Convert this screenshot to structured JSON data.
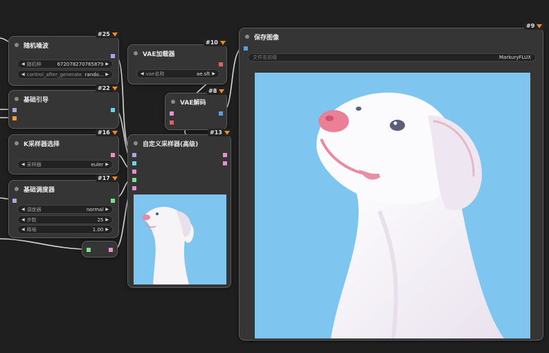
{
  "colors": {
    "background": "#1f1f1f",
    "node_body": "#353535",
    "node_border": "#5c5c5c",
    "link": "#d8d8d8",
    "slot_lavender": "#a9a6e6",
    "slot_cyan": "#6fd3e6",
    "slot_pink": "#e98fd1",
    "slot_orange": "#f0a030",
    "slot_green": "#7fe08a",
    "slot_red": "#e06060",
    "slot_blue": "#5aa0e0",
    "badge_fox": "#f08a24",
    "image_sky": "#7ec6ef"
  },
  "nodes": {
    "random_noise": {
      "title": "随机噪波",
      "id": "#25",
      "widgets": [
        {
          "label": "随机种",
          "value": "672078270765879"
        },
        {
          "label": "control_after_generate",
          "value": "rando..."
        }
      ]
    },
    "basic_guider": {
      "title": "基础引导",
      "id": "#22"
    },
    "ksampler_select": {
      "title": "K采样器选择",
      "id": "#16",
      "widgets": [
        {
          "label": "采样器",
          "value": "euler"
        }
      ]
    },
    "basic_scheduler": {
      "title": "基础调度器",
      "id": "#17",
      "widgets": [
        {
          "label": "调度器",
          "value": "normal"
        },
        {
          "label": "步数",
          "value": "25"
        },
        {
          "label": "降噪",
          "value": "1.00"
        }
      ]
    },
    "vae_loader": {
      "title": "VAE加载器",
      "id": "#10",
      "widgets": [
        {
          "label": "vae名称",
          "value": "ae.sft"
        }
      ]
    },
    "vae_decode": {
      "title": "VAE解码",
      "id": "#8"
    },
    "custom_sampler": {
      "title": "自定义采样器(高级)",
      "id": "#13"
    },
    "save_image": {
      "title": "保存图像",
      "id": "#9",
      "filename_prefix_label": "文件名前缀",
      "filename_prefix_value": "MarkuryFLUX"
    }
  }
}
